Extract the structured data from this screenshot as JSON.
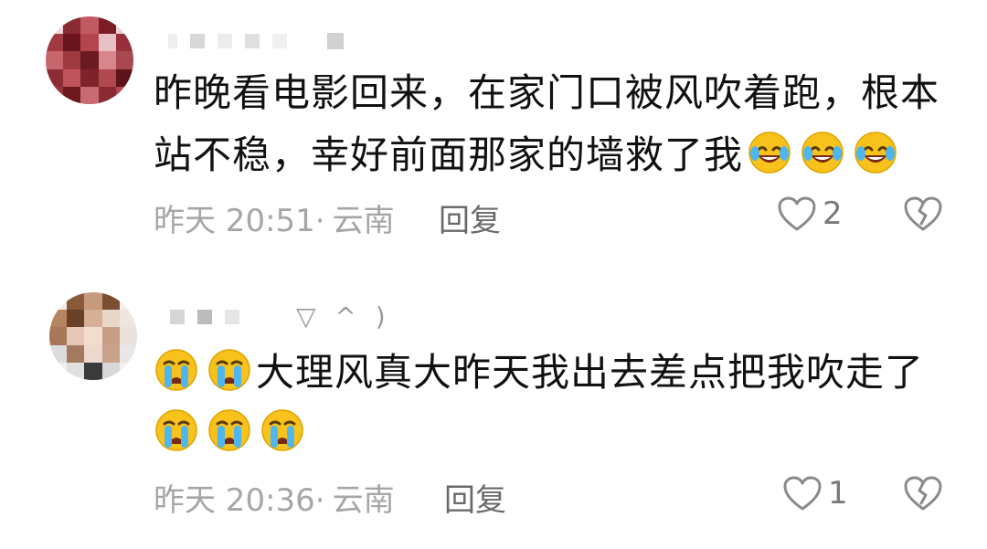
{
  "comments": [
    {
      "username_suffix": "",
      "text_line1": "昨晚看电影回来，在家门口被风吹着跑，根本",
      "text_line2": "站不稳，幸好前面那家的墙救了我",
      "trailing_emojis": [
        "laughing-tears-emoji",
        "laughing-tears-emoji",
        "laughing-tears-emoji"
      ],
      "time": "昨天 20:51·",
      "location": "云南",
      "reply_label": "回复",
      "like_count": "2"
    },
    {
      "username_suffix": "▽ ^ )",
      "leading_emojis": [
        "crying-emoji",
        "crying-emoji"
      ],
      "text_line1": "大理风真大昨天我出去差点把我吹走了",
      "trailing_emojis": [
        "crying-emoji",
        "crying-emoji",
        "crying-emoji"
      ],
      "time": "昨天 20:36·",
      "location": "云南",
      "reply_label": "回复",
      "like_count": "1"
    }
  ],
  "colors": {
    "text": "#111111",
    "meta": "#a6a6a6",
    "reply": "#6a6a6a",
    "emoji_face": "#f7c21b"
  }
}
